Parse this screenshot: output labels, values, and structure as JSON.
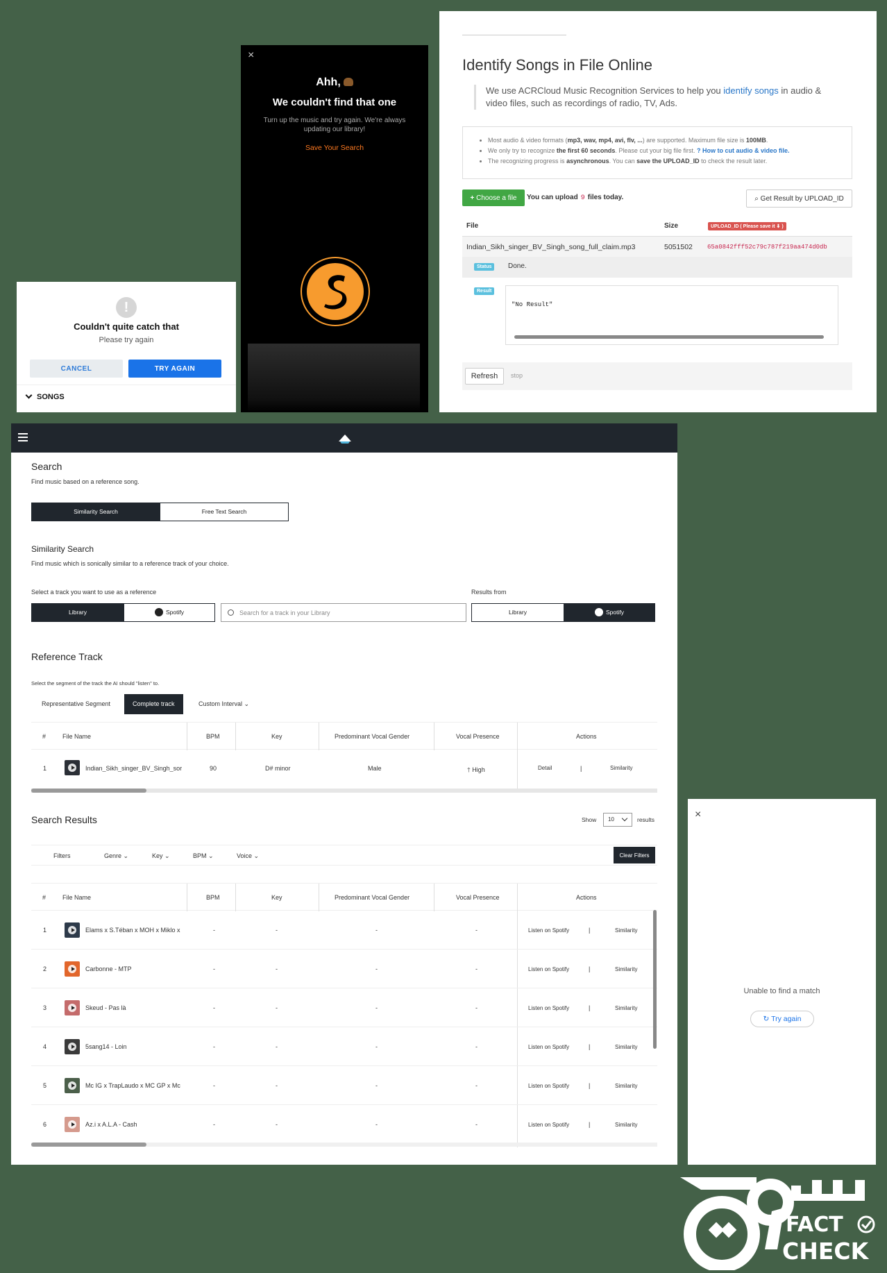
{
  "google": {
    "title": "Couldn't quite catch that",
    "subtitle": "Please try again",
    "cancel": "CANCEL",
    "retry": "TRY AGAIN",
    "songs": "SONGS"
  },
  "soundhound": {
    "close": "×",
    "ahh": "Ahh,",
    "headline": "We couldn't find that one",
    "message": "Turn up the music and try again. We're always updating our library!",
    "save": "Save Your Search"
  },
  "acr": {
    "title": "Identify Songs in File Online",
    "intro_pre": "We use ACRCloud Music Recognition Services to help you ",
    "intro_link": "identify songs",
    "intro_post": " in audio & video files, such as recordings of radio, TV, Ads.",
    "note1_pre": "Most audio & video formats (",
    "note1_formats": "mp3, wav, mp4, avi, flv, ...",
    "note1_mid": ") are supported. Maximum file size is ",
    "note1_size": "100MB",
    "note2_pre": "We only try to recognize ",
    "note2_bold": "the first 60 seconds",
    "note2_mid": ". Please cut your big file first. ",
    "note2_link": "How to cut audio & video file.",
    "note3_pre": "The recognizing progress is ",
    "note3_bold": "asynchronous",
    "note3_mid": ". You can ",
    "note3_bold2": "save the UPLOAD_ID",
    "note3_post": " to check the result later.",
    "choose": "Choose a file",
    "upload_pre": "You can upload",
    "upload_count": "9",
    "upload_post": "files today.",
    "get_result": "Get Result by UPLOAD_ID",
    "col_file": "File",
    "col_size": "Size",
    "col_id": "UPLOAD_ID ( Please save it ⬇ )",
    "file_name": "Indian_Sikh_singer_BV_Singh_song_full_claim.mp3",
    "file_size": "5051502",
    "upload_id": "65a0842fff52c79c787f219aa474d0db",
    "status_label": "Status",
    "status_value": "Done.",
    "result_label": "Result",
    "result_value": "\"No Result\"",
    "refresh": "Refresh",
    "stop": "stop",
    "colors": {
      "green": "#41a744",
      "badge": "#5bc0de",
      "red": "#d9534f",
      "link": "#2a77c8"
    }
  },
  "aims": {
    "search_title": "Search",
    "search_sub": "Find music based on a reference song.",
    "mode_similarity": "Similarity Search",
    "mode_freetext": "Free Text Search",
    "sim_title": "Similarity Search",
    "sim_sub": "Find music which is sonically similar to a reference track of your choice.",
    "select_label": "Select a track you want to use as a reference",
    "results_label": "Results from",
    "src_library": "Library",
    "src_spotify": "Spotify",
    "search_placeholder": "Search for a track in your Library",
    "ref_title": "Reference Track",
    "ref_sub": "Select the segment of the track the AI should \"listen\" to.",
    "tab_rep": "Representative Segment",
    "tab_complete": "Complete track",
    "tab_custom": "Custom Interval",
    "cols": [
      "#",
      "File Name",
      "BPM",
      "Key",
      "Predominant Vocal Gender",
      "Vocal Presence",
      "Actions"
    ],
    "ref_row": {
      "num": "1",
      "file": "Indian_Sikh_singer_BV_Singh_sor",
      "bpm": "90",
      "key": "D# minor",
      "gender": "Male",
      "presence": "High",
      "detail": "Detail",
      "sep": "|",
      "similarity": "Similarity"
    },
    "results_title": "Search Results",
    "show": "Show",
    "show_value": "10",
    "results": "results",
    "filters": "Filters",
    "f_genre": "Genre",
    "f_key": "Key",
    "f_bpm": "BPM",
    "f_voice": "Voice",
    "clear": "Clear Filters",
    "dash": "-",
    "listen": "Listen on Spotify",
    "sep": "|",
    "similarity": "Similarity",
    "rows": [
      {
        "num": "1",
        "title": "Elams x S.Téban x MOH x Miklo x"
      },
      {
        "num": "2",
        "title": "Carbonne - MTP"
      },
      {
        "num": "3",
        "title": "Skeud - Pas là"
      },
      {
        "num": "4",
        "title": "5sang14 - Loin"
      },
      {
        "num": "5",
        "title": "Mc IG x TrapLaudo x MC GP x Mc"
      },
      {
        "num": "6",
        "title": "Az.i x A.L.A - Cash"
      }
    ]
  },
  "shazam": {
    "close": "×",
    "text": "Unable to find a match",
    "retry": "Try again"
  },
  "brand": {
    "fact": "FACT",
    "check": "CHECK"
  }
}
